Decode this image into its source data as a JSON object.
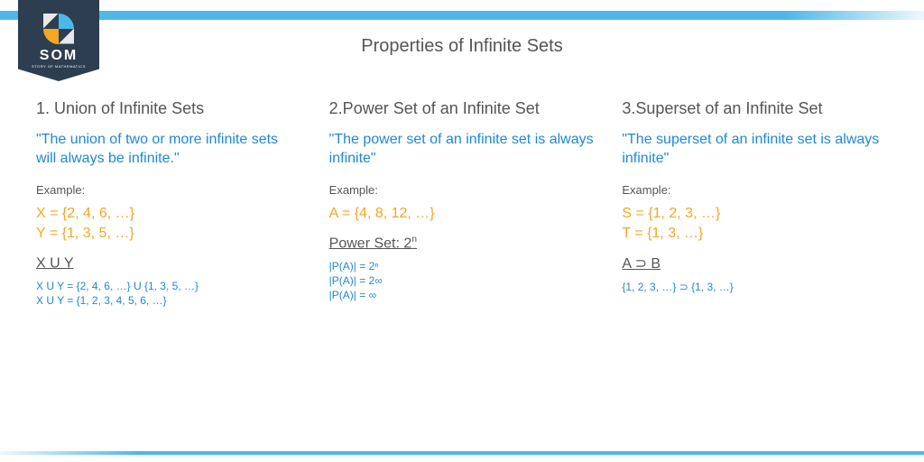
{
  "brand": {
    "name": "SOM",
    "tagline": "STORY OF MATHEMATICS"
  },
  "title": "Properties of Infinite Sets",
  "columns": [
    {
      "heading": "1. Union of Infinite Sets",
      "quote": "\"The union of two or more infinite sets will always be infinite.\"",
      "example_label": "Example:",
      "set_lines": [
        "X = {2, 4, 6, …}",
        "Y = {1, 3, 5, …}"
      ],
      "rule_heading": "X U Y",
      "rule_heading_sup": "",
      "detail_lines": [
        "X U Y = {2, 4, 6, …} U {1, 3, 5, …}",
        "X U Y = {1, 2, 3, 4, 5, 6, …}"
      ]
    },
    {
      "heading": "2.Power Set of an Infinite Set",
      "quote": "\"The power set of an infinite set is always infinite\"",
      "example_label": "Example:",
      "set_lines": [
        "A = {4, 8, 12, …}"
      ],
      "rule_heading": "Power Set: 2",
      "rule_heading_sup": "n",
      "detail_lines": [
        "|P(A)| = 2ⁿ",
        "|P(A)| = 2∞",
        "|P(A)| = ∞"
      ]
    },
    {
      "heading": "3.Superset of an Infinite Set",
      "quote": "\"The superset of an infinite set is always infinite\"",
      "example_label": "Example:",
      "set_lines": [
        "S = {1, 2, 3, …}",
        "T = {1, 3, …}"
      ],
      "rule_heading": "A ⊃ B",
      "rule_heading_sup": "",
      "detail_lines": [
        "{1, 2, 3, …} ⊃ {1, 3, …}"
      ]
    }
  ]
}
